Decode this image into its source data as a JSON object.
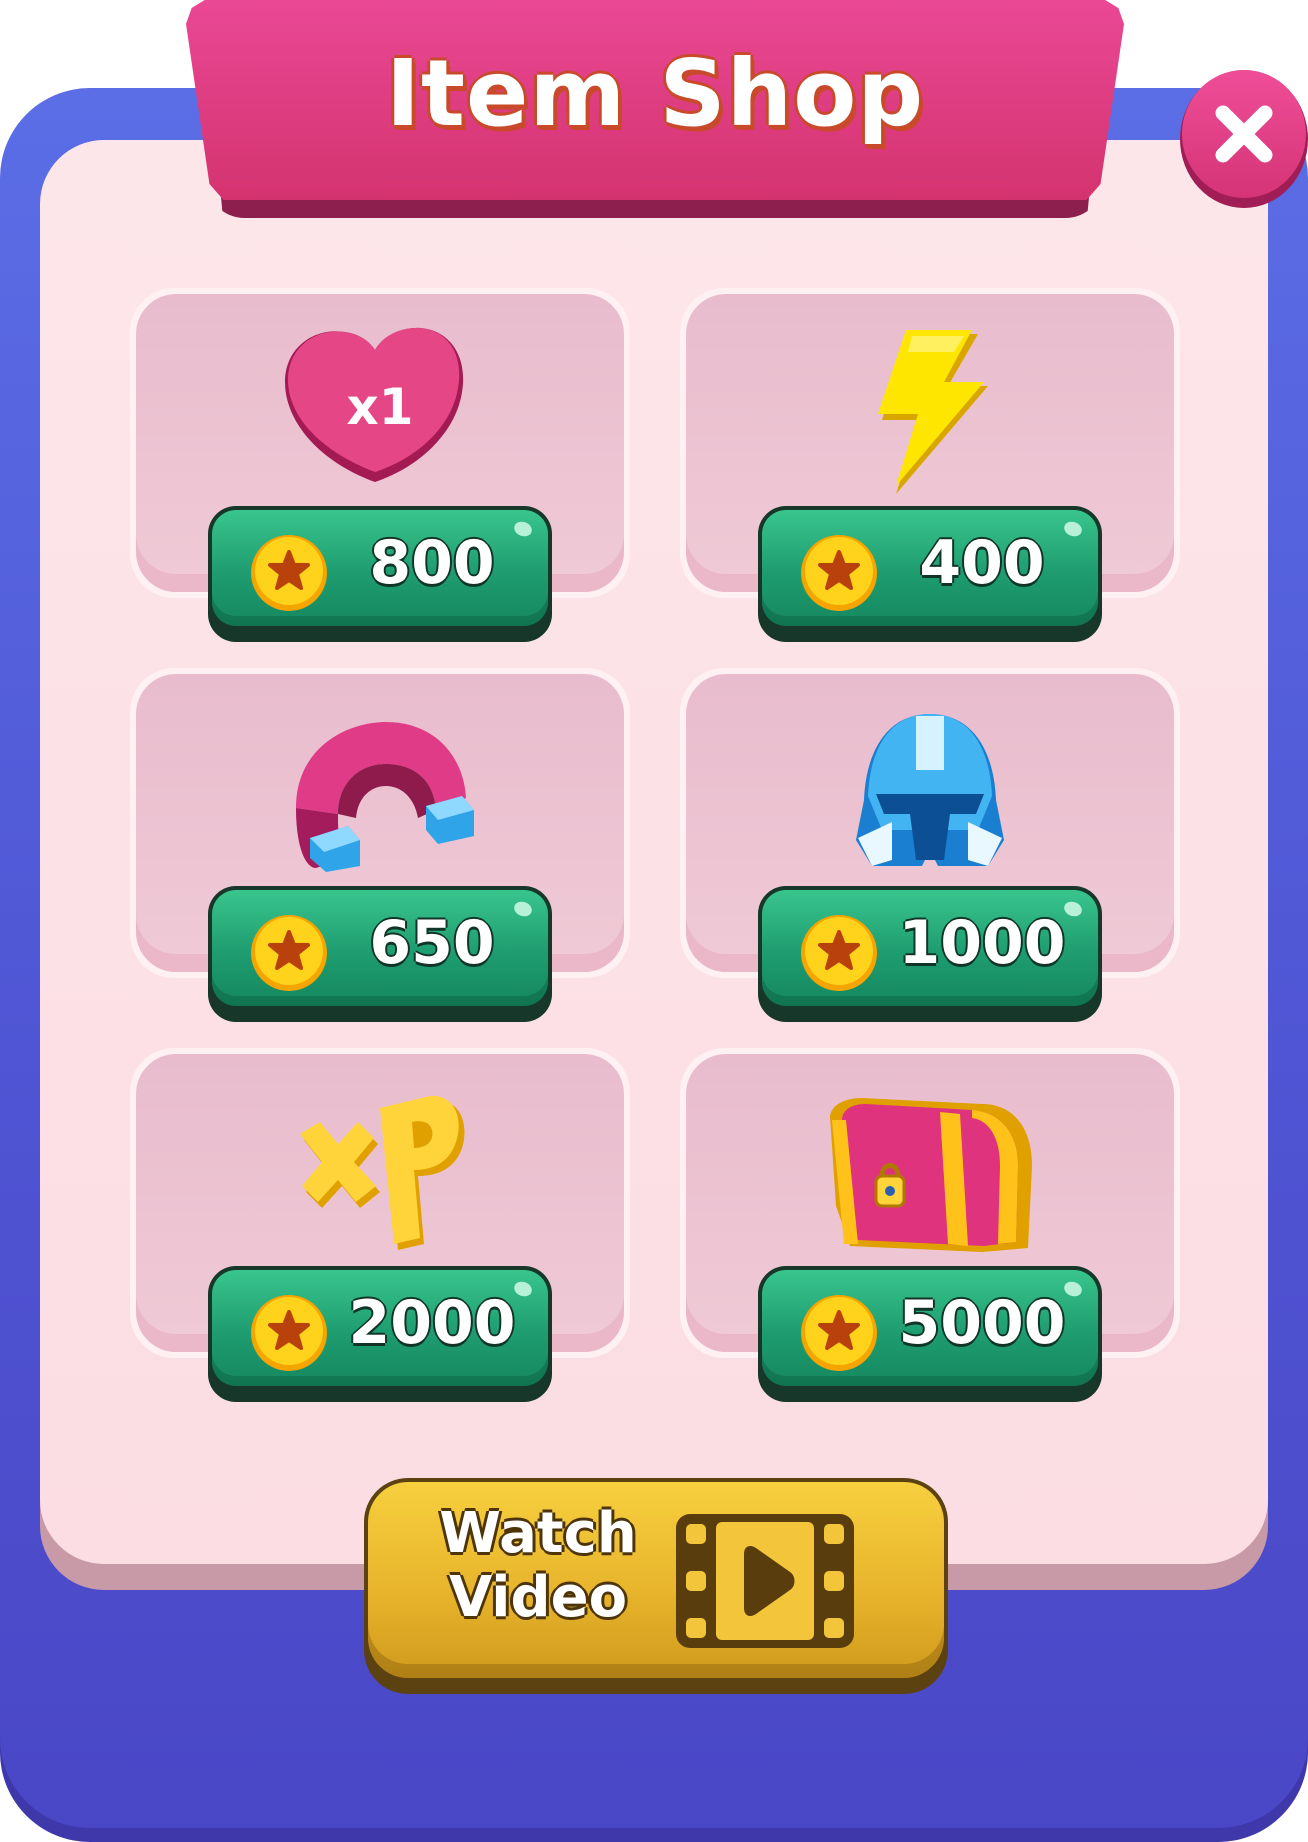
{
  "header": {
    "title": "Item Shop",
    "close_icon": "close-icon"
  },
  "colors": {
    "frame": "#5063de",
    "panel": "#fbe0e6",
    "banner": "#e0407f",
    "price_button": "#22a074",
    "video_button": "#efbe32"
  },
  "items": [
    {
      "name": "Extra Life",
      "icon": "heart-icon",
      "icon_text": "x1",
      "price": "800"
    },
    {
      "name": "Lightning",
      "icon": "lightning-icon",
      "price": "400"
    },
    {
      "name": "Magnet",
      "icon": "magnet-icon",
      "price": "650"
    },
    {
      "name": "Helmet",
      "icon": "helmet-icon",
      "price": "1000"
    },
    {
      "name": "XP",
      "icon": "xp-icon",
      "price": "2000"
    },
    {
      "name": "Treasure Chest",
      "icon": "chest-icon",
      "price": "5000"
    }
  ],
  "currency_icon": "coin-icon",
  "video_button": {
    "line1": "Watch",
    "line2": "Video",
    "icon": "film-play-icon"
  }
}
